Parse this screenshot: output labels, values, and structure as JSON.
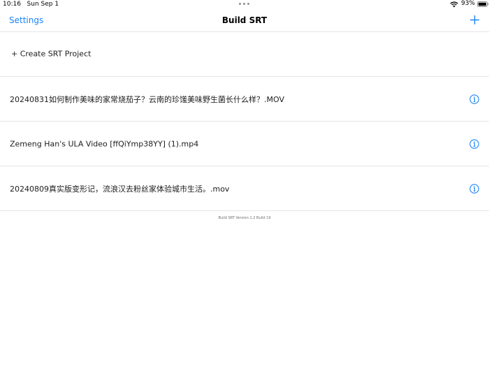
{
  "status_bar": {
    "time": "10:16",
    "date": "Sun Sep 1",
    "battery_percent": "93%"
  },
  "nav": {
    "back_label": "Settings",
    "title": "Build SRT",
    "add_icon": "plus-icon"
  },
  "create_row": {
    "label": "+ Create SRT Project"
  },
  "projects": [
    {
      "name": "20240831如何制作美味的家常烧茄子？云南的珍馐美味野生菌长什么样？.MOV",
      "icon": "info-icon"
    },
    {
      "name": "Zemeng Han's ULA Video [ffQiYmp38YY] (1).mp4",
      "icon": "info-icon"
    },
    {
      "name": "20240809真实版变形记，流浪汉去粉丝家体验城市生活。.mov",
      "icon": "info-icon"
    }
  ],
  "footer": {
    "version_text": "Build SRT Version 1.2 Build 19"
  },
  "colors": {
    "accent": "#1a84f8",
    "separator": "#e5e5ea"
  }
}
